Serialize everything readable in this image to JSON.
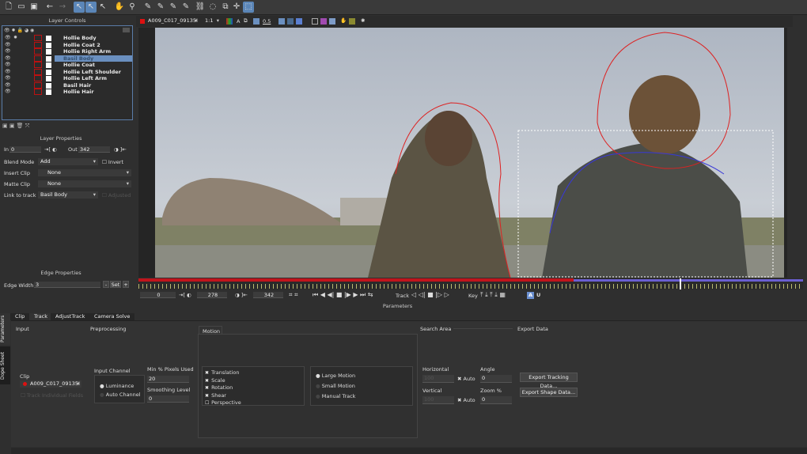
{
  "toolbar": {
    "icons": [
      "new-file",
      "open-folder",
      "save",
      "undo",
      "redo",
      "select",
      "select-b",
      "add-point",
      "hand-pan",
      "zoom",
      "x-spline",
      "x-spline-add",
      "b-spline",
      "b-spline-add",
      "link",
      "lasso",
      "transform",
      "move",
      "surface"
    ]
  },
  "layer_controls": {
    "title": "Layer Controls",
    "layers": [
      {
        "name": "Hollie Body",
        "selected": false
      },
      {
        "name": "Hollie Coat 2",
        "selected": false
      },
      {
        "name": "Hollie Right Arm",
        "selected": false
      },
      {
        "name": "Basil Body",
        "selected": true
      },
      {
        "name": "Hollie Coat",
        "selected": false
      },
      {
        "name": "Hollie Left Shoulder",
        "selected": false
      },
      {
        "name": "Hollie Left Arm",
        "selected": false
      },
      {
        "name": "Basil Hair",
        "selected": false
      },
      {
        "name": "Hollie Hair",
        "selected": false
      }
    ]
  },
  "layer_properties": {
    "title": "Layer Properties",
    "in_label": "In",
    "in_value": "0",
    "out_label": "Out",
    "out_value": "342",
    "blend_label": "Blend Mode",
    "blend_value": "Add",
    "invert_label": "Invert",
    "insert_label": "Insert Clip",
    "insert_value": "None",
    "matte_label": "Matte Clip",
    "matte_value": "None",
    "link_label": "Link to track",
    "link_value": "Basil Body",
    "adjusted_label": "Adjusted"
  },
  "edge_properties": {
    "title": "Edge Properties",
    "width_label": "Edge Width",
    "width_value": "3",
    "minus": "-",
    "set": "Set",
    "plus": "+"
  },
  "viewer": {
    "clip": "A009_C017_09135I",
    "zoom": "1:1",
    "alpha_label": "A",
    "opacity": "0.5"
  },
  "timeline": {
    "start": "0",
    "current": "278",
    "end": "342",
    "track_label": "Track",
    "key_label": "Key",
    "key_a": "A",
    "key_u": "U",
    "colors": {
      "range": "#c0141c",
      "tracked": "#6a5fd0"
    }
  },
  "parameters": {
    "title": "Parameters",
    "side_tabs": [
      "Parameters",
      "Dope Sheet"
    ],
    "tabs": [
      "Clip",
      "Track",
      "AdjustTrack",
      "Camera Solve"
    ],
    "active_tab": "Track",
    "input": {
      "title": "Input",
      "clip_label": "Clip",
      "clip_value": "A009_C017_09135I",
      "track_individual": "Track Individual Fields"
    },
    "preprocessing": {
      "title": "Preprocessing",
      "channel_label": "Input Channel",
      "channels": [
        "Luminance",
        "Auto Channel"
      ],
      "selected_channel": "Luminance",
      "min_pixels_label": "Min % Pixels Used",
      "min_pixels_value": "20",
      "smoothing_label": "Smoothing Level",
      "smoothing_value": "0"
    },
    "motion": {
      "title": "Motion",
      "options": [
        {
          "label": "Translation",
          "checked": true
        },
        {
          "label": "Scale",
          "checked": true
        },
        {
          "label": "Rotation",
          "checked": true
        },
        {
          "label": "Shear",
          "checked": true
        },
        {
          "label": "Perspective",
          "checked": false
        }
      ],
      "modes": [
        "Large Motion",
        "Small Motion",
        "Manual Track"
      ],
      "selected_mode": "Large Motion"
    },
    "search_area": {
      "title": "Search Area",
      "horizontal_label": "Horizontal",
      "horizontal_value": "100",
      "vertical_label": "Vertical",
      "vertical_value": "100",
      "auto_label": "Auto",
      "angle_label": "Angle",
      "angle_value": "0",
      "zoom_label": "Zoom %",
      "zoom_value": "0"
    },
    "export": {
      "title": "Export Data",
      "tracking": "Export Tracking Data...",
      "shape": "Export Shape Data..."
    }
  }
}
